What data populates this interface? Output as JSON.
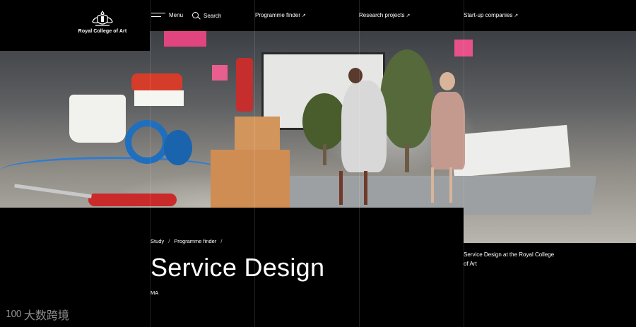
{
  "brand": {
    "name": "Royal College of Art",
    "logo_icon": "crest-icon"
  },
  "nav": {
    "menu_label": "Menu",
    "search_label": "Search",
    "links": [
      {
        "label": "Programme finder",
        "arrow": "↗"
      },
      {
        "label": "Research projects",
        "arrow": "↗"
      },
      {
        "label": "Start-up companies",
        "arrow": "↗"
      }
    ]
  },
  "breadcrumb": {
    "items": [
      "Study",
      "Programme finder"
    ],
    "separator": "/"
  },
  "page": {
    "title": "Service Design",
    "degree": "MA"
  },
  "hero": {
    "caption": "Service Design at the Royal College of Art"
  },
  "watermark": {
    "mark": "100",
    "text": "大数跨境"
  },
  "colors": {
    "background": "#000000",
    "text": "#ffffff"
  }
}
